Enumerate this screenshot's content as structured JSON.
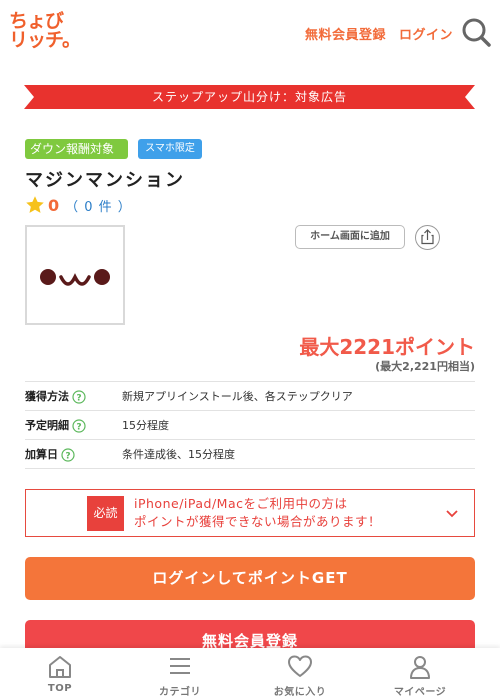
{
  "header": {
    "logo_line1": "ちょび",
    "logo_line2": "リッチ。",
    "register_link": "無料会員登録",
    "login_link": "ログイン",
    "search_icon": "search-icon"
  },
  "ribbon": {
    "text": "ステップアップ山分け：対象広告"
  },
  "badges": {
    "reward": "ダウン報酬対象",
    "platform": "スマホ限定"
  },
  "app": {
    "title": "マジンマンション",
    "rating_value": "0",
    "rating_count": "（ 0 件 ）",
    "icon": "kaomoji-app-icon"
  },
  "actions": {
    "home_screen": "ホーム画面に追加",
    "share_icon": "share-icon"
  },
  "reward": {
    "points": "最大2221ポイント",
    "yen": "(最大2,221円相当)"
  },
  "info": [
    {
      "label": "獲得方法",
      "value": "新規アプリインストール後、各ステップクリア"
    },
    {
      "label": "予定明細",
      "value": "15分程度"
    },
    {
      "label": "加算日",
      "value": "条件達成後、15分程度"
    }
  ],
  "notice": {
    "badge": "必読",
    "line1": "iPhone/iPad/Macをご利用中の方は",
    "line2": "ポイントが獲得できない場合があります！"
  },
  "buttons": {
    "login_get": "ログインしてポイントGET",
    "register": "無料会員登録"
  },
  "bottom_nav": [
    {
      "label": "TOP",
      "icon": "home-icon"
    },
    {
      "label": "カテゴリ",
      "icon": "menu-icon"
    },
    {
      "label": "お気に入り",
      "icon": "heart-icon"
    },
    {
      "label": "マイページ",
      "icon": "user-icon"
    }
  ],
  "colors": {
    "brand_orange": "#f26b3a",
    "ribbon_red": "#e8322e",
    "badge_green": "#7fc93f",
    "badge_blue": "#3fa0ea",
    "points_red": "#f15a4a",
    "login_button": "#f4753a",
    "register_button": "#f0474a"
  }
}
